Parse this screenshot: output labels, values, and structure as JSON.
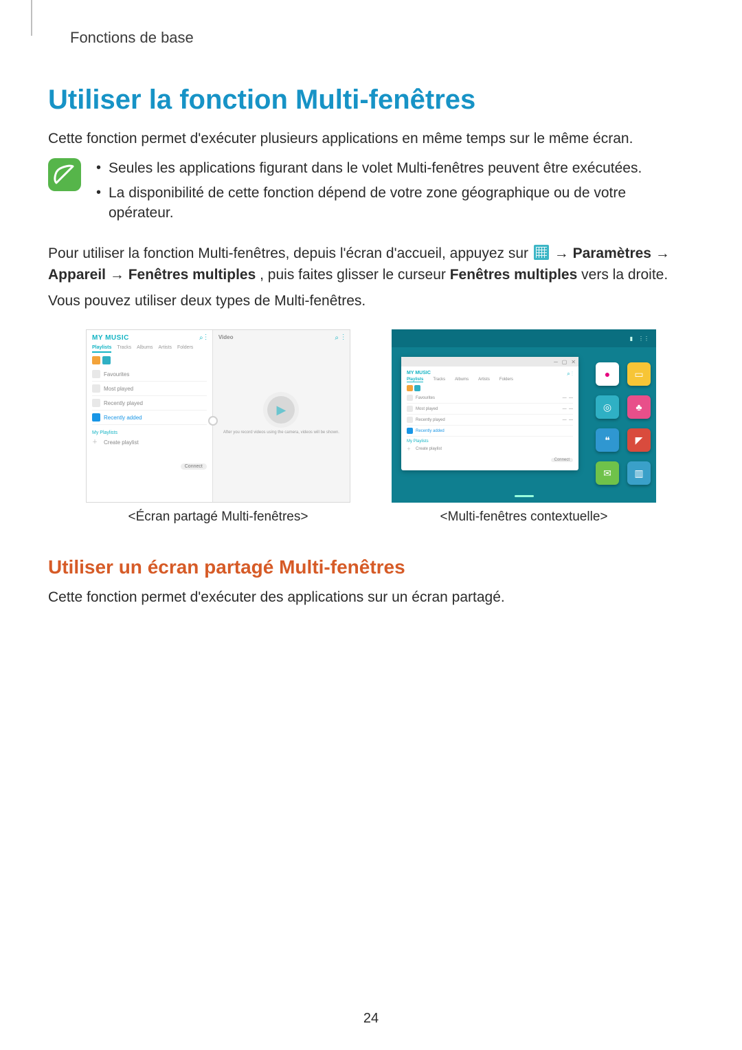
{
  "header": {
    "section": "Fonctions de base"
  },
  "heading": "Utiliser la fonction Multi-fenêtres",
  "intro": "Cette fonction permet d'exécuter plusieurs applications en même temps sur le même écran.",
  "note": {
    "bullet1": "Seules les applications figurant dans le volet Multi-fenêtres peuvent être exécutées.",
    "bullet2": "La disponibilité de cette fonction dépend de votre zone géographique ou de votre opérateur."
  },
  "instruction": {
    "p1a": "Pour utiliser la fonction Multi-fenêtres, depuis l'écran d'accueil, appuyez sur ",
    "p1b": " → ",
    "settings": "Paramètres",
    "arrow2": " → ",
    "device": "Appareil",
    "arrow3": " → ",
    "multiwin": "Fenêtres multiples",
    "p1c": ", puis faites glisser le curseur ",
    "multiwin2": "Fenêtres multiples",
    "p1d": " vers la droite.",
    "p2": "Vous pouvez utiliser deux types de Multi-fenêtres."
  },
  "figures": {
    "left_caption": "<Écran partagé Multi-fenêtres>",
    "right_caption": "<Multi-fenêtres contextuelle>",
    "fig1": {
      "music_title": "MY MUSIC",
      "tabs": {
        "playlists": "Playlists",
        "tracks": "Tracks",
        "albums": "Albums",
        "artists": "Artists",
        "folders": "Folders"
      },
      "rows": {
        "fav": "Favourites",
        "most": "Most played",
        "recplay": "Recently played",
        "recadd": "Recently added"
      },
      "myplaylists": "My Playlists",
      "create": "Create playlist",
      "connect": "Connect",
      "video_title": "Video",
      "video_sub": "After you record videos using the camera, videos will be shown."
    },
    "fig2": {
      "popup_title": "MY MUSIC",
      "tabs": {
        "playlists": "Playlists",
        "tracks": "Tracks",
        "albums": "Albums",
        "artists": "Artists",
        "folders": "Folders"
      },
      "rows": {
        "fav": "Favourites",
        "most": "Most played",
        "recplay": "Recently played",
        "recadd": "Recently added"
      },
      "myplaylists": "My Playlists",
      "create": "Create playlist",
      "connect": "Connect",
      "dash1": "—",
      "dash2": "—"
    }
  },
  "subheading": "Utiliser un écran partagé Multi-fenêtres",
  "subintro": "Cette fonction permet d'exécuter des applications sur un écran partagé.",
  "page_number": "24"
}
